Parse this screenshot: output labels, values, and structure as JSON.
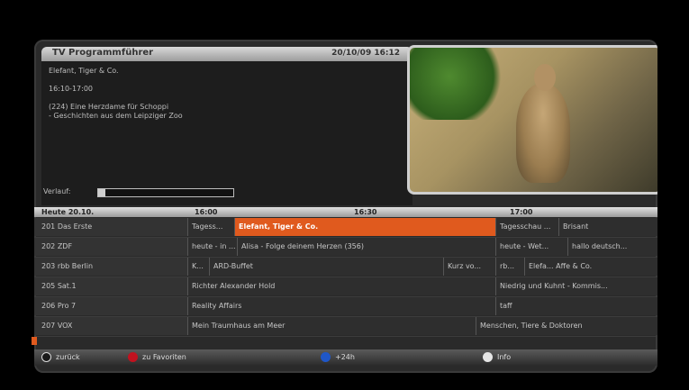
{
  "header": {
    "title": "TV Programmführer",
    "datetime": "20/10/09 16:12"
  },
  "info": {
    "program_title": "Elefant, Tiger & Co.",
    "time_range": "16:10-17:00",
    "description_line1": "(224) Eine Herzdame für Schoppi",
    "description_line2": "- Geschichten aus dem Leipziger Zoo",
    "progress_label": "Verlauf:",
    "progress_fraction": 0.05
  },
  "timeline": {
    "day": "Heute 20.10.",
    "times": [
      "16:00",
      "16:30",
      "17:00"
    ]
  },
  "channels": [
    {
      "name": "201 Das Erste",
      "programs": [
        "Tagess...",
        "Elefant, Tiger & Co.",
        "Tagesschau ...",
        "Brisant"
      ]
    },
    {
      "name": "202 ZDF",
      "programs": [
        "heute - in ...",
        "Alisa - Folge deinem Herzen (356)",
        "heute - Wet...",
        "hallo deutsch..."
      ]
    },
    {
      "name": "203 rbb Berlin",
      "programs": [
        "K...",
        "ARD-Buffet",
        "Kurz vo...",
        "rb...",
        "Elefa... Affe & Co."
      ]
    },
    {
      "name": "205 Sat.1",
      "programs": [
        "Richter Alexander Hold",
        "Niedrig und Kuhnt - Kommis..."
      ]
    },
    {
      "name": "206 Pro 7",
      "programs": [
        "Reality Affairs",
        "taff"
      ]
    },
    {
      "name": "207 VOX",
      "programs": [
        "Mein Traumhaus am Meer",
        "Menschen, Tiere & Doktoren"
      ]
    }
  ],
  "bottom_bar": {
    "back_label": "zurück",
    "red_label": "zu Favoriten",
    "blue_label": "+24h",
    "white_label": "Info"
  },
  "colors": {
    "selected": "#e05a1e",
    "red_button": "#c1121f",
    "blue_button": "#1f57c8"
  }
}
